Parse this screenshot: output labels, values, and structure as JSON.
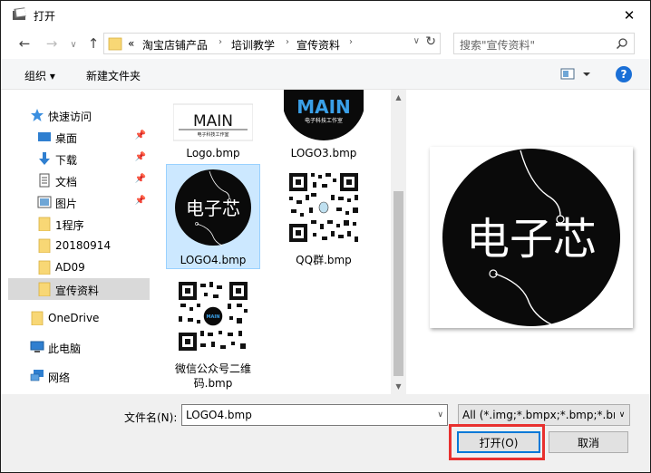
{
  "window": {
    "title": "打开",
    "close_icon": "close-icon"
  },
  "nav": {
    "breadcrumbs": [
      "淘宝店铺产品",
      "培训教学",
      "宣传资料"
    ],
    "prefix": "«",
    "search_placeholder": "搜索\"宣传资料\""
  },
  "toolbar": {
    "organize_label": "组织 ▾",
    "new_folder_label": "新建文件夹",
    "help_label": "?"
  },
  "sidebar": {
    "items": [
      {
        "label": "快速访问",
        "icon": "star-icon",
        "pinned": false
      },
      {
        "label": "桌面",
        "icon": "desktop-icon",
        "pinned": true
      },
      {
        "label": "下载",
        "icon": "download-icon",
        "pinned": true
      },
      {
        "label": "文档",
        "icon": "document-icon",
        "pinned": true
      },
      {
        "label": "图片",
        "icon": "picture-icon",
        "pinned": true
      },
      {
        "label": "1程序",
        "icon": "folder-icon",
        "pinned": false
      },
      {
        "label": "20180914",
        "icon": "folder-icon",
        "pinned": false
      },
      {
        "label": "AD09",
        "icon": "folder-icon",
        "pinned": false
      },
      {
        "label": "宣传资料",
        "icon": "folder-icon",
        "pinned": false,
        "selected": true
      },
      {
        "label": "OneDrive",
        "icon": "folder-icon",
        "pinned": false
      },
      {
        "label": "此电脑",
        "icon": "computer-icon",
        "pinned": false
      },
      {
        "label": "网络",
        "icon": "network-icon",
        "pinned": false
      }
    ]
  },
  "files": [
    {
      "name": "Logo.bmp",
      "thumb": "main-logo-white"
    },
    {
      "name": "LOGO3.bmp",
      "thumb": "main-logo-black"
    },
    {
      "name": "LOGO4.bmp",
      "thumb": "dianzixin-logo",
      "selected": true
    },
    {
      "name": "QQ群.bmp",
      "thumb": "qr-code"
    },
    {
      "name": "微信公众号二维码.bmp",
      "thumb": "qr-code-main"
    }
  ],
  "thumb_text": {
    "main": "MAIN",
    "main_sub": "电子科技工作室",
    "logo4": "电子芯"
  },
  "preview": {
    "text": "电子芯"
  },
  "bottom": {
    "filename_label": "文件名(N):",
    "filename_value": "LOGO4.bmp",
    "filetype_value": "All (*.img;*.bmpx;*.bmp;*.bm",
    "open_label": "打开(O)",
    "cancel_label": "取消"
  },
  "colors": {
    "accent": "#0078d7",
    "highlight": "#e8312f",
    "selection": "#cce8ff",
    "folder": "#f8d775",
    "help": "#1a6fd6"
  }
}
